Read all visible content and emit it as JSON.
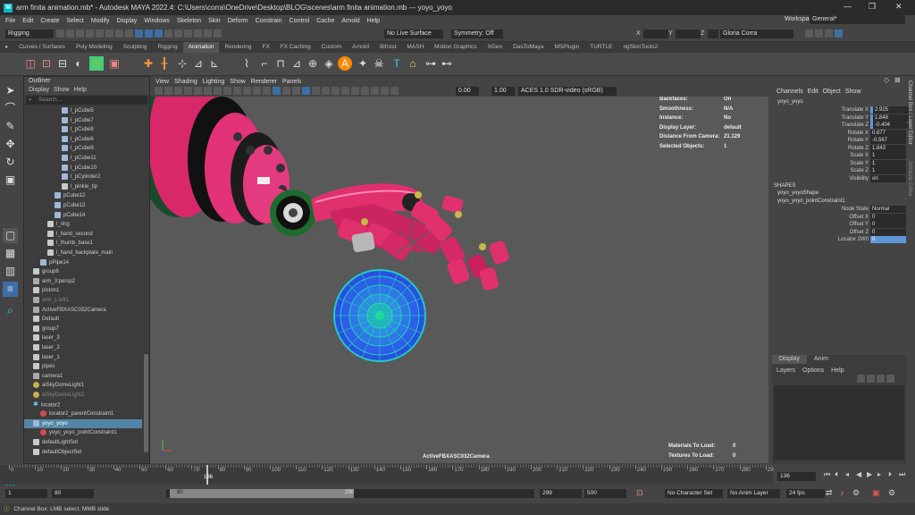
{
  "window": {
    "title": "arm finita animation.mb* - Autodesk MAYA 2022.4: C:\\Users\\corra\\OneDrive\\Desktop\\BLOG\\scenes\\arm finita animation.mb   ---   yoyo_yoyo",
    "logo": "M"
  },
  "menubar": {
    "items": [
      "File",
      "Edit",
      "Create",
      "Select",
      "Modify",
      "Display",
      "Windows",
      "Skeleton",
      "Skin",
      "Deform",
      "Constrain",
      "Control",
      "Cache",
      "Arnold",
      "Help"
    ],
    "workspace_label": "Workspace :",
    "workspace_value": "General*"
  },
  "statusline": {
    "menuset": "Rigging",
    "live_surface": "No Live Surface",
    "symmetry": "Symmetry: Off",
    "x_label": "X",
    "y_label": "Y",
    "z_label": "Z",
    "user": "Gloria Corra"
  },
  "shelf": {
    "tabs": [
      "Curves / Surfaces",
      "Poly Modeling",
      "Sculpting",
      "Rigging",
      "Animation",
      "Rendering",
      "FX",
      "FX Caching",
      "Custom",
      "Arnold",
      "Bifrost",
      "MASH",
      "Motion Graphics",
      "XGen",
      "DasToMaya",
      "MSPlugin",
      "TURTLE",
      "ngSkinTools2"
    ],
    "active_tab": "Animation"
  },
  "outliner": {
    "title": "Outliner",
    "menu": [
      "Display",
      "Show",
      "Help"
    ],
    "search_placeholder": "Search...",
    "items": [
      {
        "label": "l_pCube5",
        "icon": "mesh",
        "indent": 4
      },
      {
        "label": "l_pCube7",
        "icon": "mesh",
        "indent": 4
      },
      {
        "label": "l_pCube8",
        "icon": "mesh",
        "indent": 4
      },
      {
        "label": "l_pCube6",
        "icon": "mesh",
        "indent": 4
      },
      {
        "label": "l_pCube9",
        "icon": "mesh",
        "indent": 4
      },
      {
        "label": "l_pCube11",
        "icon": "mesh",
        "indent": 4
      },
      {
        "label": "l_pCube10",
        "icon": "mesh",
        "indent": 4
      },
      {
        "label": "l_pCylinder2",
        "icon": "mesh",
        "indent": 4
      },
      {
        "label": "l_pinkie_tip",
        "icon": "group",
        "indent": 4
      },
      {
        "label": "pCube12",
        "icon": "mesh",
        "indent": 3
      },
      {
        "label": "pCube13",
        "icon": "mesh",
        "indent": 3
      },
      {
        "label": "pCube14",
        "icon": "mesh",
        "indent": 3
      },
      {
        "label": "l_ring",
        "icon": "group",
        "indent": 2
      },
      {
        "label": "l_hand_second",
        "icon": "group",
        "indent": 2
      },
      {
        "label": "l_thumb_base1",
        "icon": "group",
        "indent": 2
      },
      {
        "label": "l_hand_backplate_main",
        "icon": "group",
        "indent": 2
      },
      {
        "label": "pPipe14",
        "icon": "mesh",
        "indent": 1
      },
      {
        "label": "group6",
        "icon": "group",
        "indent": 0
      },
      {
        "label": "arm_3:persp2",
        "icon": "camera",
        "indent": 0
      },
      {
        "label": "piston1",
        "icon": "group",
        "indent": 0
      },
      {
        "label": "arm_1:left1",
        "icon": "camera",
        "indent": 0,
        "dim": true
      },
      {
        "label": "ActiveFBXASC032Camera",
        "icon": "camera",
        "indent": 0
      },
      {
        "label": "Default",
        "icon": "group",
        "indent": 0
      },
      {
        "label": "group7",
        "icon": "group",
        "indent": 0
      },
      {
        "label": "laser_3",
        "icon": "group",
        "indent": 0
      },
      {
        "label": "laser_2",
        "icon": "group",
        "indent": 0
      },
      {
        "label": "laser_1",
        "icon": "group",
        "indent": 0
      },
      {
        "label": "pipes",
        "icon": "group",
        "indent": 0
      },
      {
        "label": "camera1",
        "icon": "camera",
        "indent": 0
      },
      {
        "label": "aiSkyDomeLight1",
        "icon": "light",
        "indent": 0
      },
      {
        "label": "aiSkyDomeLight2",
        "icon": "light",
        "indent": 0,
        "dim": true
      },
      {
        "label": "locator2",
        "icon": "locator",
        "indent": 0
      },
      {
        "label": "locator2_parentConstraint1",
        "icon": "constraint",
        "indent": 1
      },
      {
        "label": "yoyo_yoyo",
        "icon": "mesh",
        "indent": 0,
        "selected": true
      },
      {
        "label": "yoyo_yoyo_pointConstraint1",
        "icon": "constraint",
        "indent": 1
      },
      {
        "label": "defaultLightSet",
        "icon": "group",
        "indent": 0
      },
      {
        "label": "defaultObjectSet",
        "icon": "group",
        "indent": 0
      }
    ]
  },
  "viewport": {
    "menu": [
      "View",
      "Shading",
      "Lighting",
      "Show",
      "Renderer",
      "Panels"
    ],
    "exposure": "0.00",
    "gamma": "1.00",
    "colorspace": "ACES 1.0 SDR-video (sRGB)",
    "hud_top": [
      {
        "label": "Backfaces:",
        "value": "On"
      },
      {
        "label": "Smoothness:",
        "value": "N/A"
      },
      {
        "label": "Instance:",
        "value": "No"
      },
      {
        "label": "Display Layer:",
        "value": "default"
      },
      {
        "label": "Distance From Camera:",
        "value": "21.129"
      },
      {
        "label": "Selected Objects:",
        "value": "1"
      }
    ],
    "hud_bottom": [
      {
        "label": "Materials To Load:",
        "value": "0"
      },
      {
        "label": "Textures To Load:",
        "value": "0"
      }
    ],
    "camera_name": "ActiveFBXASC032Camera"
  },
  "channelbox": {
    "menu": [
      "Channels",
      "Edit",
      "Object",
      "Show"
    ],
    "object": "yoyo_yoyo",
    "channels": [
      {
        "label": "Translate X",
        "value": "2.925",
        "highlight": true
      },
      {
        "label": "Translate Y",
        "value": "1.848",
        "highlight": true
      },
      {
        "label": "Translate Z",
        "value": "-0.404",
        "highlight": true
      },
      {
        "label": "Rotate X",
        "value": "0.677"
      },
      {
        "label": "Rotate Y",
        "value": "-0.567"
      },
      {
        "label": "Rotate Z",
        "value": "1.843"
      },
      {
        "label": "Scale X",
        "value": "1"
      },
      {
        "label": "Scale Y",
        "value": "1"
      },
      {
        "label": "Scale Z",
        "value": "1"
      },
      {
        "label": "Visibility",
        "value": "on"
      }
    ],
    "shapes_header": "SHAPES",
    "shape_name": "yoyo_yoyoShape",
    "constraint_name": "yoyo_yoyo_pointConstraint1",
    "constraint_channels": [
      {
        "label": "Node State",
        "value": "Normal"
      },
      {
        "label": "Offset X",
        "value": "0"
      },
      {
        "label": "Offset Y",
        "value": "0"
      },
      {
        "label": "Offset Z",
        "value": "0"
      },
      {
        "label": "Locator 2W0",
        "value": "0",
        "blue": true
      }
    ]
  },
  "layers": {
    "tabs": [
      "Display",
      "Anim"
    ],
    "menu": [
      "Layers",
      "Options",
      "Help"
    ]
  },
  "side_tabs": [
    "Channel Box / Layer Editor",
    "Attribute Editor"
  ],
  "timeline": {
    "ticks": [
      "0",
      "10",
      "20",
      "30",
      "40",
      "50",
      "60",
      "70",
      "80",
      "90",
      "100",
      "110",
      "120",
      "130",
      "140",
      "150",
      "160",
      "170",
      "180",
      "190",
      "200",
      "210",
      "220",
      "230",
      "240",
      "250",
      "260",
      "270",
      "280",
      "290"
    ],
    "current_frame": "136",
    "current_frame_field": "136"
  },
  "range": {
    "start": "1",
    "inner_start": "80",
    "slider_start": "80",
    "slider_end": "290",
    "inner_end": "299",
    "end": "500",
    "character_set": "No Character Set",
    "anim_layer": "No Anim Layer",
    "fps": "24 fps"
  },
  "helpline": {
    "text": "Channel Box: LMB select. MMB slide"
  },
  "colors": {
    "accent": "#5285a6",
    "maya_logo": "#00b7c7",
    "arm_pink": "#e0306e",
    "yoyo_blue": "#2a5fd8"
  }
}
